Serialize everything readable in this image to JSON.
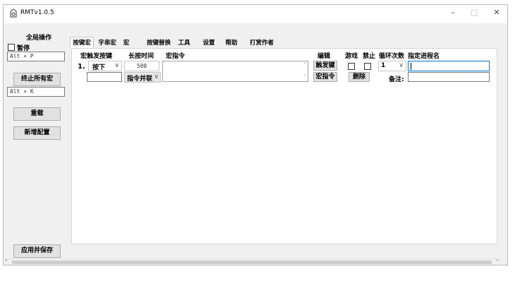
{
  "window": {
    "title": "RMTv1.0.5",
    "minimize": "–",
    "maximize": "□",
    "close": "✕"
  },
  "sidebar": {
    "group_title": "全局操作",
    "pause_label": "暂停",
    "pause_hotkey": "Alt + P",
    "stop_all": "终止所有宏",
    "stop_hotkey": "Alt + K",
    "reload": "重载",
    "new_config": "新增配置",
    "apply_save": "应用并保存"
  },
  "tabs": [
    "按键宏",
    "字串宏",
    "宏",
    "按键替换",
    "工具",
    "设置",
    "帮助",
    "打赏作者"
  ],
  "headers": {
    "trigger_key": "宏触发按键",
    "hold_time": "长按时间",
    "macro_cmd": "宏指令",
    "edit": "编辑",
    "game": "游戏",
    "disable": "禁止",
    "loop_count": "循环次数",
    "process_name": "指定进程名"
  },
  "row": {
    "index": "1.",
    "trigger_mode": "按下",
    "hold_time": "500",
    "cmd_mode": "指令并联",
    "trigger_btn": "触发键",
    "macro_btn": "宏指令",
    "delete_btn": "删除",
    "loop_count": "1",
    "note_label": "备注:"
  },
  "icons": {
    "app": "app-logo-icon",
    "dropdown": "chevron-down-icon",
    "scroll_up": "scroll-up-icon",
    "scroll_down": "scroll-down-icon"
  }
}
